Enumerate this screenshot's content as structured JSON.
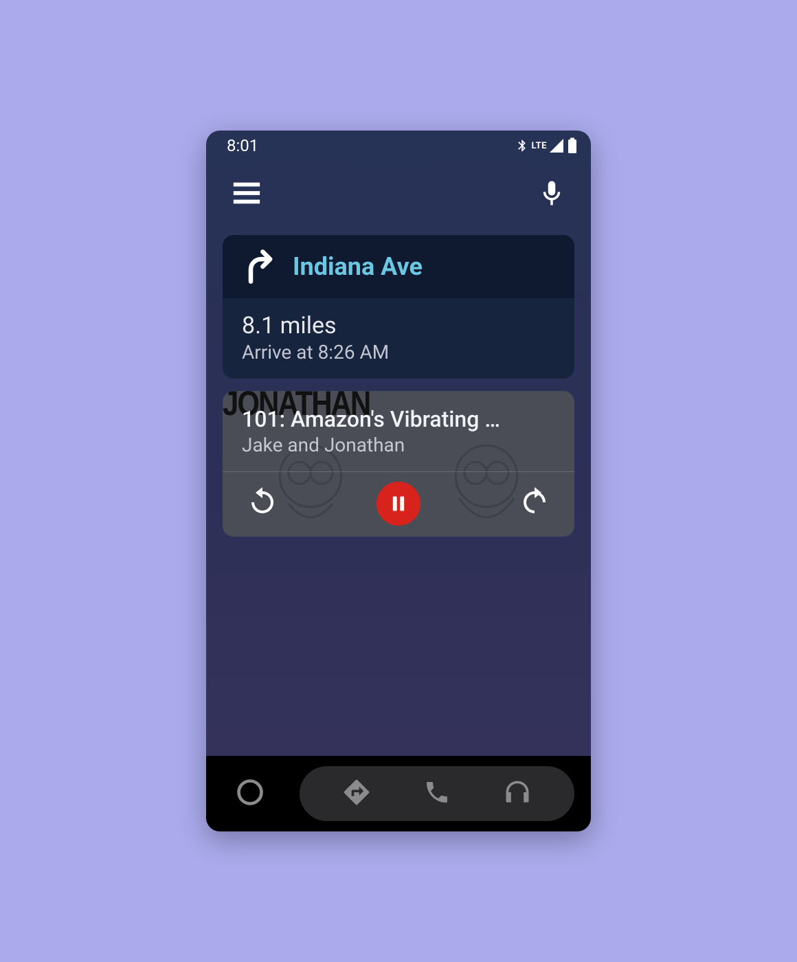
{
  "statusbar": {
    "time": "8:01",
    "network_label": "LTE"
  },
  "navigation": {
    "street": "Indiana Ave",
    "distance": "8.1 miles",
    "arrival": "Arrive at 8:26 AM"
  },
  "media": {
    "title": "101: Amazon's Vibrating …",
    "subtitle": "Jake and Jonathan"
  }
}
